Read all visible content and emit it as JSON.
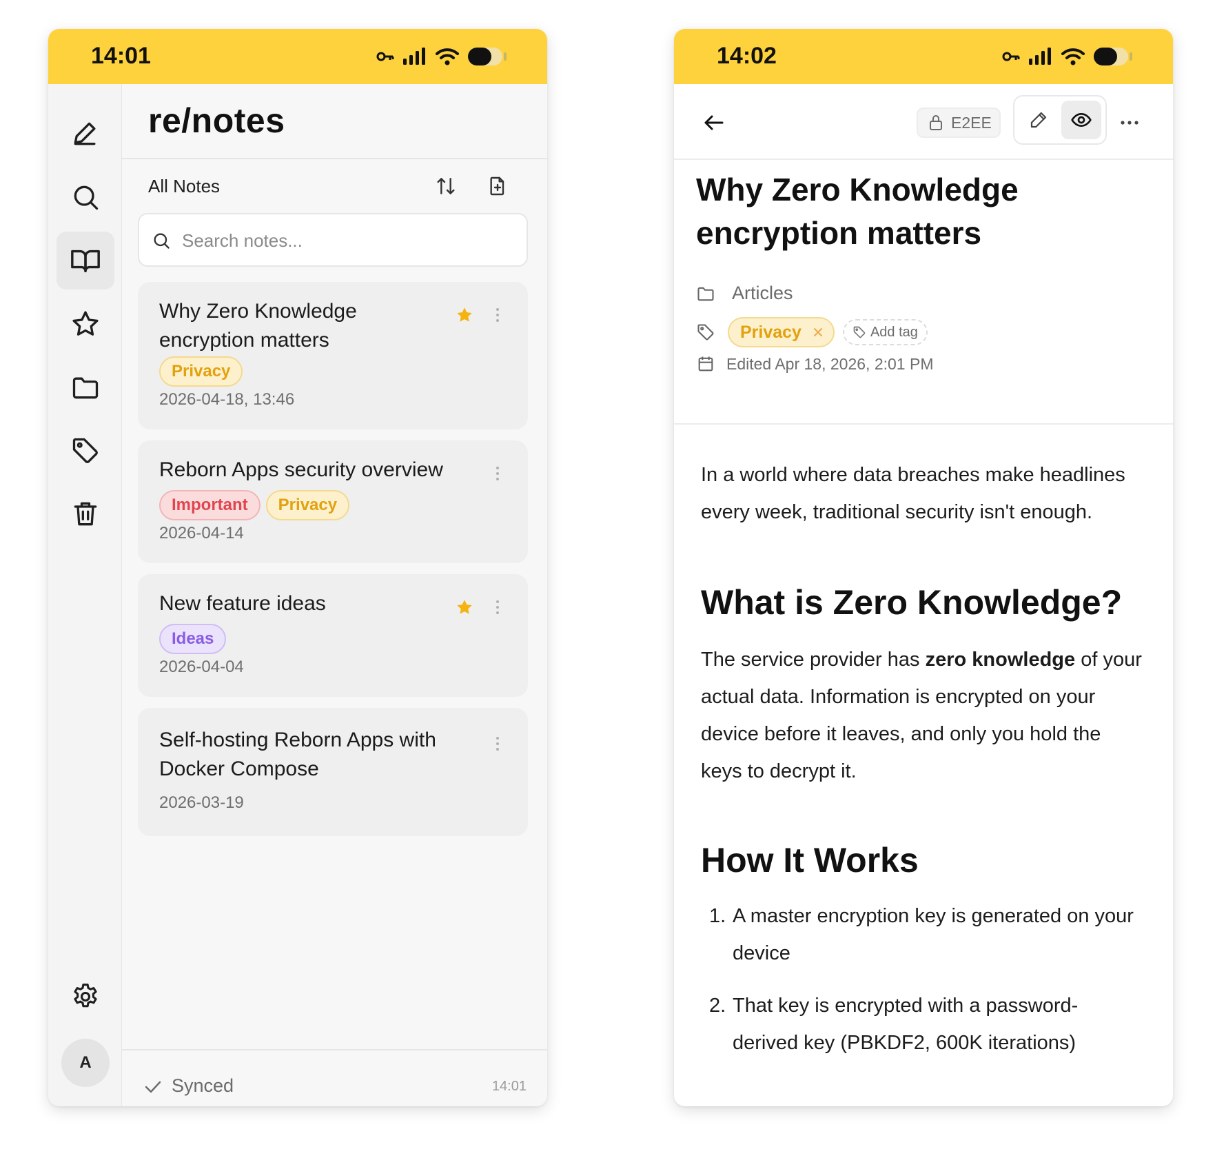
{
  "colors": {
    "accent_yellow": "#fdd23c",
    "star": "#f5b312",
    "tag_privacy_bg": "#fdf1cd",
    "tag_privacy_text": "#e2a10f",
    "tag_important_bg": "#fbdcdc",
    "tag_important_text": "#e0464f",
    "tag_ideas_bg": "#ebe2fb",
    "tag_ideas_text": "#8a5ce6"
  },
  "left": {
    "status": {
      "time": "14:01"
    },
    "rail": {
      "items": [
        "new-note",
        "search",
        "all-notes",
        "favorites",
        "folders",
        "tags",
        "trash"
      ],
      "active": "all-notes",
      "avatar_initial": "A"
    },
    "app_logo": "re/notes",
    "list_title": "All Notes",
    "search": {
      "placeholder": "Search notes..."
    },
    "notes": [
      {
        "title": "Why Zero Knowledge encryption matters",
        "starred": true,
        "tags": [
          "Privacy"
        ],
        "date": "2026-04-18, 13:46"
      },
      {
        "title": "Reborn Apps security overview",
        "starred": false,
        "tags": [
          "Important",
          "Privacy"
        ],
        "date": "2026-04-14"
      },
      {
        "title": "New feature ideas",
        "starred": true,
        "tags": [
          "Ideas"
        ],
        "date": "2026-04-04"
      },
      {
        "title": "Self-hosting Reborn Apps with Docker Compose",
        "starred": false,
        "tags": [],
        "date": "2026-03-19"
      }
    ],
    "sync": {
      "label": "Synced",
      "time": "14:01"
    }
  },
  "right": {
    "status": {
      "time": "14:02"
    },
    "toolbar": {
      "e2ee_label": "E2EE",
      "mode": "preview"
    },
    "doc": {
      "title": "Why Zero Knowledge encryption matters",
      "folder": "Articles",
      "tag": "Privacy",
      "add_tag_label": "Add tag",
      "edited": "Edited Apr 18, 2026, 2:01 PM",
      "intro": "In a world where data breaches make headlines every week, traditional security isn't enough.",
      "h2_1": "What is Zero Knowledge?",
      "para2_before": "The service provider has ",
      "para2_bold": "zero knowledge",
      "para2_after": " of your actual data. Information is encrypted on your device before it leaves, and only you hold the keys to decrypt it.",
      "h2_2": "How It Works",
      "steps": [
        "A master encryption key is generated on your device",
        "That key is encrypted with a password-derived key (PBKDF2, 600K iterations)"
      ]
    }
  }
}
